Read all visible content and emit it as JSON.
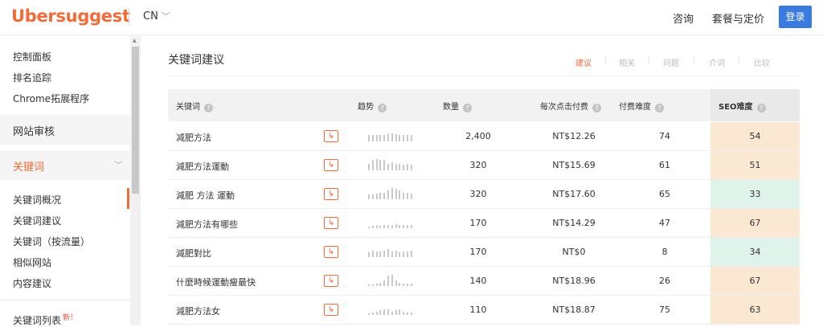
{
  "header": {
    "logo": "Ubersuggest",
    "country": "CN",
    "nav": [
      "咨询",
      "套餐与定价"
    ],
    "login": "登录"
  },
  "sidebar": {
    "items_top": [
      "控制面板",
      "排名追踪",
      "Chrome拓展程序"
    ],
    "site_audit": "网站审核",
    "keywords_section": "关键词",
    "keyword_items": [
      "关键词概况",
      "关键词建议",
      "关键词（按流量）",
      "相似网站",
      "内容建议"
    ],
    "keyword_list": "关键词列表",
    "new_badge": "新！"
  },
  "panel": {
    "title": "关键词建议",
    "tabs": [
      "建议",
      "相关",
      "问题",
      "介词",
      "比较"
    ],
    "active_tab": "建议"
  },
  "table": {
    "headers": [
      "关键词",
      "趋势",
      "数量",
      "每次点击付费",
      "付费难度",
      "SEO难度"
    ],
    "rows": [
      {
        "keyword": "减肥方法",
        "volume": "2,400",
        "cpc": "NT$12.26",
        "pd": "74",
        "sd": "54",
        "trend": [
          0.6,
          0.6,
          0.6,
          0.6,
          0.6,
          0.65,
          0.7,
          0.65,
          0.6,
          0.6,
          0.6,
          0.6
        ],
        "sd_color": "#fbe8d3"
      },
      {
        "keyword": "減肥方法運動",
        "volume": "320",
        "cpc": "NT$15.69",
        "pd": "61",
        "sd": "51",
        "trend": [
          0.6,
          0.9,
          1.0,
          0.9,
          0.9,
          0.6,
          0.7,
          0.55,
          0.6,
          0.5,
          0.6,
          0.5
        ],
        "sd_color": "#fbe8d3"
      },
      {
        "keyword": "減肥 方法 運動",
        "volume": "320",
        "cpc": "NT$17.60",
        "pd": "65",
        "sd": "33",
        "trend": [
          0.4,
          0.4,
          0.5,
          0.6,
          0.6,
          0.8,
          1.0,
          0.9,
          0.8,
          0.6,
          0.55,
          0.5
        ],
        "sd_color": "#dff3ea"
      },
      {
        "keyword": "減肥方法有哪些",
        "volume": "170",
        "cpc": "NT$14.29",
        "pd": "47",
        "sd": "67",
        "trend": [
          0.1,
          0.2,
          0.3,
          0.2,
          0.3,
          0.3,
          0.3,
          0.35,
          0.3,
          0.3,
          0.3,
          0.3
        ],
        "sd_color": "#fbe8d3"
      },
      {
        "keyword": "減肥對比",
        "volume": "170",
        "cpc": "NT$0",
        "pd": "8",
        "sd": "34",
        "trend": [
          0.4,
          0.6,
          0.5,
          0.5,
          0.6,
          0.7,
          0.5,
          0.6,
          0.4,
          0.5,
          0.5,
          0.6
        ],
        "sd_color": "#dff3ea"
      },
      {
        "keyword": "什麼時候運動瘦最快",
        "volume": "140",
        "cpc": "NT$18.96",
        "pd": "26",
        "sd": "67",
        "trend": [
          0.1,
          0.1,
          0.2,
          0.3,
          0.5,
          0.9,
          1.0,
          0.5,
          0.3,
          0.2,
          0.2,
          0.2
        ],
        "sd_color": "#fbe8d3"
      },
      {
        "keyword": "減肥方法女",
        "volume": "110",
        "cpc": "NT$18.87",
        "pd": "75",
        "sd": "63",
        "trend": [
          0.1,
          0.2,
          0.3,
          0.4,
          0.5,
          0.5,
          0.3,
          0.4,
          0.5,
          0.3,
          0.2,
          0.2
        ],
        "sd_color": "#fbe8d3"
      }
    ]
  },
  "colors": {
    "brand": "#f26b38",
    "login_blue": "#3a7be0"
  }
}
